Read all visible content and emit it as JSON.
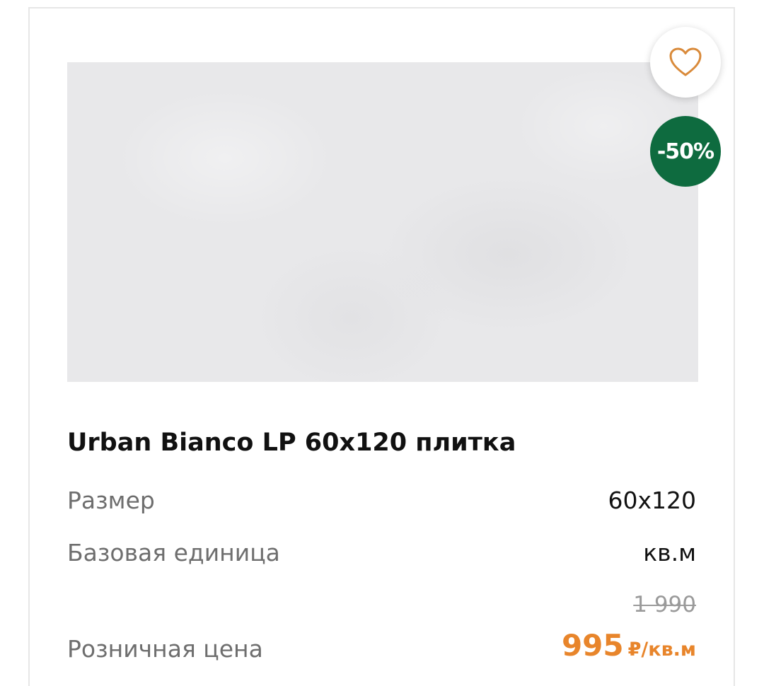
{
  "product": {
    "title": "Urban Bianco LP 60x120 плитка",
    "discount_badge": "-50%",
    "favorite_icon": "heart-outline-icon",
    "image_description": "light gray concrete-look tile",
    "specs": [
      {
        "label": "Размер",
        "value": "60x120"
      },
      {
        "label": "Базовая единица",
        "value": "кв.м"
      }
    ],
    "price": {
      "label": "Розничная цена",
      "old_value": "1 990",
      "current_value": "995",
      "unit": "₽/кв.м"
    }
  },
  "colors": {
    "accent_price": "#e8852b",
    "badge_green": "#0e6b3f",
    "heart_icon": "#d98a3a"
  }
}
